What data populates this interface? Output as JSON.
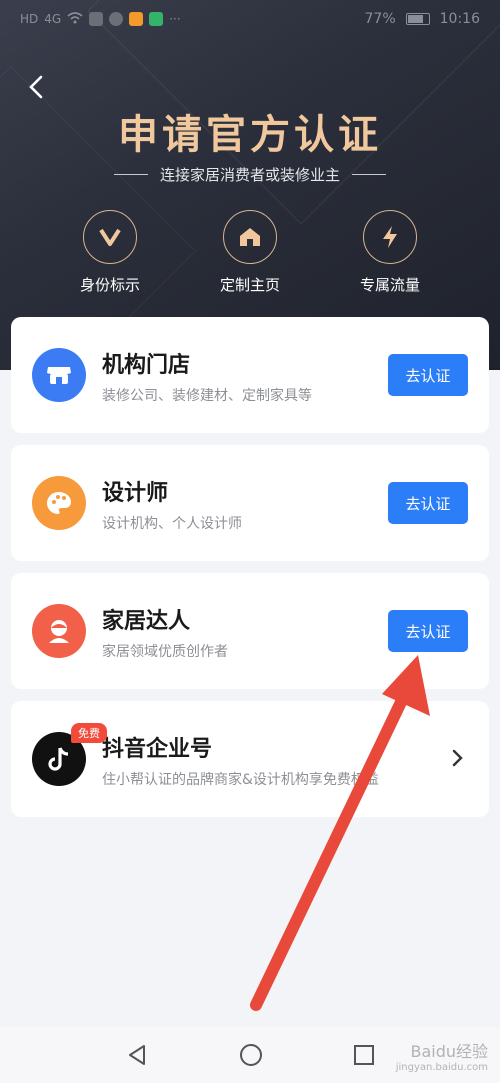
{
  "status_bar": {
    "left": [
      "HD",
      "4G"
    ],
    "battery": "77%",
    "time": "10:16"
  },
  "header": {
    "title": "申请官方认证",
    "subtitle": "连接家居消费者或装修业主"
  },
  "features": [
    {
      "label": "身份标示",
      "icon": "v-badge-icon"
    },
    {
      "label": "定制主页",
      "icon": "home-icon"
    },
    {
      "label": "专属流量",
      "icon": "lightning-icon"
    }
  ],
  "cards": [
    {
      "name": "机构门店",
      "desc": "装修公司、装修建材、定制家具等",
      "button": "去认证",
      "icon": "store-icon",
      "color": "#3b7cf5"
    },
    {
      "name": "设计师",
      "desc": "设计机构、个人设计师",
      "button": "去认证",
      "icon": "palette-icon",
      "color": "#f79a3c"
    },
    {
      "name": "家居达人",
      "desc": "家居领域优质创作者",
      "button": "去认证",
      "icon": "person-icon",
      "color": "#f2604a"
    },
    {
      "name": "抖音企业号",
      "desc": "住小帮认证的品牌商家&设计机构享免费权益",
      "badge": "免费",
      "icon": "douyin-icon",
      "color": "#111111"
    }
  ],
  "watermark": {
    "brand": "Baidu经验",
    "url": "jingyan.baidu.com"
  },
  "colors": {
    "accent": "#2c7ef8",
    "gold": "#f1c89e",
    "arrow": "#e8493a"
  }
}
